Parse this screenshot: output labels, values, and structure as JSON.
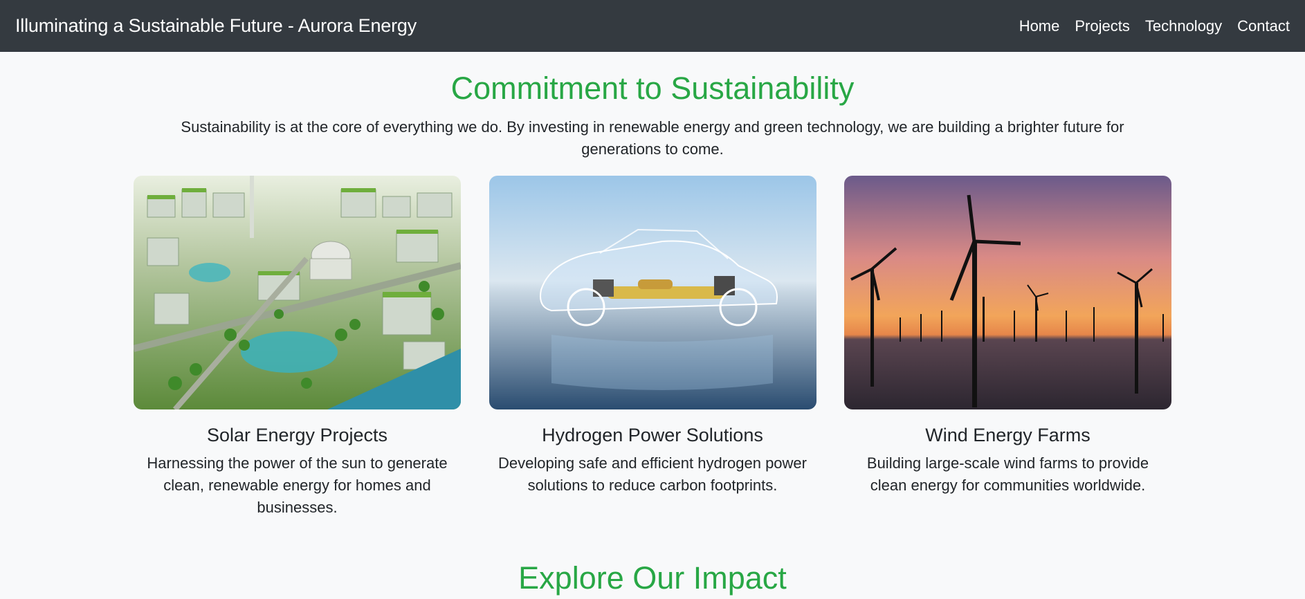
{
  "navbar": {
    "brand": "Illuminating a Sustainable Future - Aurora Energy",
    "links": [
      {
        "label": "Home"
      },
      {
        "label": "Projects"
      },
      {
        "label": "Technology"
      },
      {
        "label": "Contact"
      }
    ]
  },
  "sustainability": {
    "title": "Commitment to Sustainability",
    "intro": "Sustainability is at the core of everything we do. By investing in renewable energy and green technology, we are building a brighter future for generations to come."
  },
  "cards": [
    {
      "title": "Solar Energy Projects",
      "text": "Harnessing the power of the sun to generate clean, renewable energy for homes and businesses."
    },
    {
      "title": "Hydrogen Power Solutions",
      "text": "Developing safe and efficient hydrogen power solutions to reduce carbon footprints."
    },
    {
      "title": "Wind Energy Farms",
      "text": "Building large-scale wind farms to provide clean energy for communities worldwide."
    }
  ],
  "explore": {
    "title": "Explore Our Impact"
  },
  "colors": {
    "navbar_bg": "#343a40",
    "accent_green": "#28a745",
    "page_bg": "#f8f9fa"
  }
}
